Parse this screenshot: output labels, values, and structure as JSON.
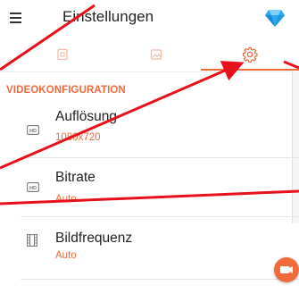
{
  "appbar": {
    "title": "Einstellungen",
    "menu_icon": "hamburger-menu-icon",
    "premium_icon": "diamond-icon"
  },
  "tabs": [
    {
      "icon": "camera-frame-icon",
      "active": false
    },
    {
      "icon": "image-icon",
      "active": false
    },
    {
      "icon": "gear-icon",
      "active": true
    }
  ],
  "section": {
    "header": "VIDEOKONFIGURATION"
  },
  "settings": [
    {
      "icon": "hd-icon",
      "label": "Auflösung",
      "value": "1080x720"
    },
    {
      "icon": "hd-icon",
      "label": "Bitrate",
      "value": "Auto"
    },
    {
      "icon": "film-strip-icon",
      "label": "Bildfrequenz",
      "value": "Auto"
    }
  ],
  "fab": {
    "icon": "record-camera-icon"
  },
  "colors": {
    "accent": "#f06a3c",
    "annotation_red": "#e8101a",
    "diamond": "#2aa8f0"
  }
}
